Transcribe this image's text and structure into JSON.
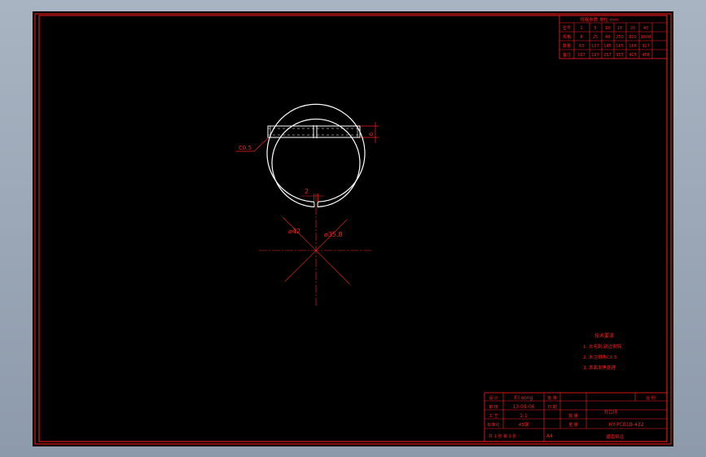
{
  "spec_table": {
    "title": "规格参数 单位:mm",
    "rows": [
      [
        "型号",
        "1",
        "5",
        "10",
        "16",
        "20",
        "40"
      ],
      [
        "规格",
        "8",
        "25",
        "40",
        "250",
        "800",
        "2000"
      ],
      [
        "数量",
        "63",
        "137",
        "145",
        "165",
        "166",
        "317"
      ],
      [
        "备注",
        "167",
        "197",
        "257",
        "335",
        "415",
        "458"
      ]
    ]
  },
  "dimensions": {
    "chamfer": "C0.5",
    "thickness": "6",
    "gap": "2",
    "outer_diameter": "⌀42",
    "inner_diameter": "⌀35.8"
  },
  "notes": {
    "title": "技术要求",
    "items": [
      "1. 去毛刺,锐边倒钝",
      "2. 未注倒角C0.5",
      "3. 表面发黑处理"
    ]
  },
  "title_block": {
    "labels": [
      "设 计",
      "审 核",
      "工 艺",
      "标准化",
      "批 准",
      "日 期"
    ],
    "designer": "F.l.song",
    "date": "13-09-06",
    "scale_value": "1:1",
    "material": "45钢",
    "qty_label": "数 量",
    "weight_label": "重 量",
    "part_name": "开口环",
    "scale_label": "比 例",
    "drawing_no": "HY-PCB1B-432",
    "company": "湖南恒远",
    "left_footer": "共 1 张  第 1 张",
    "sheet_size": "A4",
    "right_footer": "装配零件图"
  }
}
